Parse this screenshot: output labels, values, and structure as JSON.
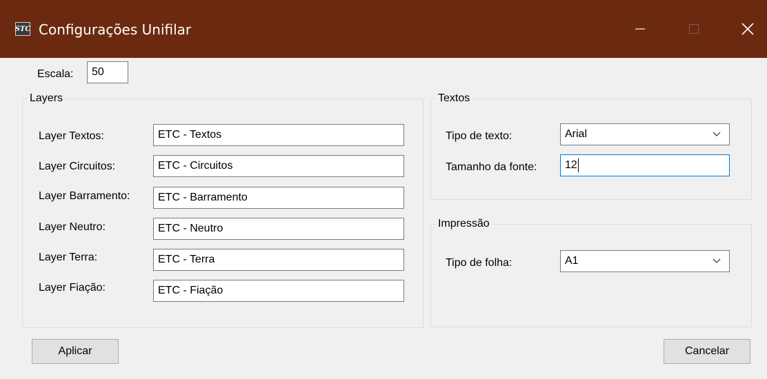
{
  "window": {
    "title": "Configurações Unifilar",
    "icon_text": "STC",
    "icon_name": "app-logo-icon",
    "titlebar_color": "#6b2a10",
    "controls": [
      "minimize-icon",
      "maximize-icon",
      "close-icon"
    ]
  },
  "escala": {
    "label": "Escala:",
    "value": "50"
  },
  "layers": {
    "title": "Layers",
    "rows": [
      {
        "label": "Layer Textos:",
        "value": "ETC - Textos"
      },
      {
        "label": "Layer Circuitos:",
        "value": "ETC - Circuitos"
      },
      {
        "label": "Layer Barramento:",
        "value": "ETC - Barramento"
      },
      {
        "label": "Layer Neutro:",
        "value": "ETC - Neutro"
      },
      {
        "label": "Layer Terra:",
        "value": "ETC - Terra"
      },
      {
        "label": "Layer Fiação:",
        "value": "ETC - Fiação"
      }
    ]
  },
  "textos": {
    "title": "Textos",
    "tipo_label": "Tipo de texto:",
    "tipo_value": "Arial",
    "tamanho_label": "Tamanho da fonte:",
    "tamanho_value": "12"
  },
  "impressao": {
    "title": "Impressão",
    "folha_label": "Tipo de folha:",
    "folha_value": "A1"
  },
  "buttons": {
    "aplicar": "Aplicar",
    "cancelar": "Cancelar"
  },
  "colors": {
    "focus_border": "#0078d7",
    "background": "#f0f0f0"
  }
}
